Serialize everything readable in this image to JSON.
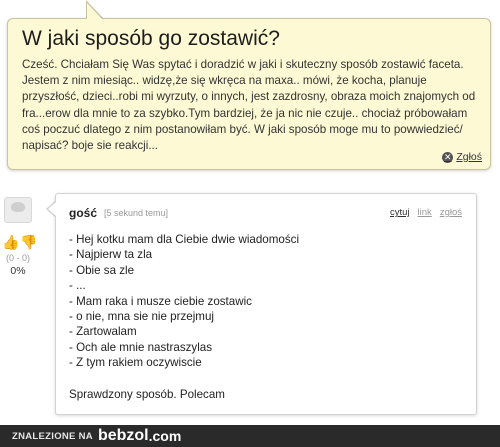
{
  "question": {
    "title": "W jaki sposób go zostawić?",
    "body": "Cześć. Chciałam Się Was spytać i doradzić w jaki i skuteczny sposób zostawić faceta. Jestem z nim miesiąc.. widzę,że się wkręca na maxa.. mówi, że kocha, planuje przyszłość, dzieci..robi mi wyrzuty, o innych, jest zazdrosny, obraza moich znajomych od fra...erow dla mnie to za szybko.Tym bardziej, że ja nic nie czuje.. chociaż próbowałam coś poczuć dlatego z nim postanowiłam być. W jaki sposób moge mu to powwiedzieć/ napisać? boje sie reakcji...",
    "report_label": "Zgłoś"
  },
  "answer": {
    "author": "gość",
    "time": "[5 sekund temu]",
    "actions": {
      "quote": "cytuj",
      "link": "link",
      "report": "zgłoś"
    },
    "lines": [
      "- Hej kotku mam dla Ciebie dwie wiadomości",
      "- Najpierw ta zla",
      "- Obie sa zle",
      "- ...",
      "- Mam raka i musze ciebie zostawic",
      "- o nie, mna sie nie przejmuj",
      "- Zartowalam",
      "- Och ale mnie nastraszylas",
      "- Z tym rakiem oczywiscie"
    ],
    "footer": "Sprawdzony sposób. Polecam"
  },
  "votes": {
    "counts": "(0 - 0)",
    "percent": "0%"
  },
  "bottom_bar": {
    "text": "ZNALEZIONE NA",
    "brand": "bebzol",
    "tld": ".com"
  },
  "colors": {
    "question_bg": "#fdf9d5",
    "bottom_bar_bg": "#2a2a2a"
  },
  "icons": [
    "report-icon",
    "thumbs-up-icon",
    "thumbs-down-icon",
    "avatar-icon"
  ]
}
